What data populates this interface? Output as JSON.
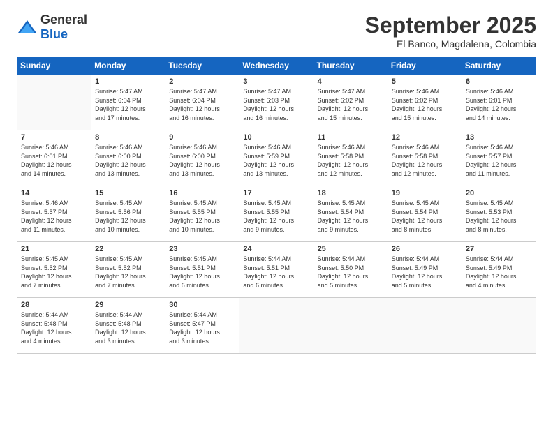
{
  "header": {
    "logo_general": "General",
    "logo_blue": "Blue",
    "month": "September 2025",
    "location": "El Banco, Magdalena, Colombia"
  },
  "weekdays": [
    "Sunday",
    "Monday",
    "Tuesday",
    "Wednesday",
    "Thursday",
    "Friday",
    "Saturday"
  ],
  "weeks": [
    [
      {
        "day": "",
        "info": ""
      },
      {
        "day": "1",
        "info": "Sunrise: 5:47 AM\nSunset: 6:04 PM\nDaylight: 12 hours\nand 17 minutes."
      },
      {
        "day": "2",
        "info": "Sunrise: 5:47 AM\nSunset: 6:04 PM\nDaylight: 12 hours\nand 16 minutes."
      },
      {
        "day": "3",
        "info": "Sunrise: 5:47 AM\nSunset: 6:03 PM\nDaylight: 12 hours\nand 16 minutes."
      },
      {
        "day": "4",
        "info": "Sunrise: 5:47 AM\nSunset: 6:02 PM\nDaylight: 12 hours\nand 15 minutes."
      },
      {
        "day": "5",
        "info": "Sunrise: 5:46 AM\nSunset: 6:02 PM\nDaylight: 12 hours\nand 15 minutes."
      },
      {
        "day": "6",
        "info": "Sunrise: 5:46 AM\nSunset: 6:01 PM\nDaylight: 12 hours\nand 14 minutes."
      }
    ],
    [
      {
        "day": "7",
        "info": "Sunrise: 5:46 AM\nSunset: 6:01 PM\nDaylight: 12 hours\nand 14 minutes."
      },
      {
        "day": "8",
        "info": "Sunrise: 5:46 AM\nSunset: 6:00 PM\nDaylight: 12 hours\nand 13 minutes."
      },
      {
        "day": "9",
        "info": "Sunrise: 5:46 AM\nSunset: 6:00 PM\nDaylight: 12 hours\nand 13 minutes."
      },
      {
        "day": "10",
        "info": "Sunrise: 5:46 AM\nSunset: 5:59 PM\nDaylight: 12 hours\nand 13 minutes."
      },
      {
        "day": "11",
        "info": "Sunrise: 5:46 AM\nSunset: 5:58 PM\nDaylight: 12 hours\nand 12 minutes."
      },
      {
        "day": "12",
        "info": "Sunrise: 5:46 AM\nSunset: 5:58 PM\nDaylight: 12 hours\nand 12 minutes."
      },
      {
        "day": "13",
        "info": "Sunrise: 5:46 AM\nSunset: 5:57 PM\nDaylight: 12 hours\nand 11 minutes."
      }
    ],
    [
      {
        "day": "14",
        "info": "Sunrise: 5:46 AM\nSunset: 5:57 PM\nDaylight: 12 hours\nand 11 minutes."
      },
      {
        "day": "15",
        "info": "Sunrise: 5:45 AM\nSunset: 5:56 PM\nDaylight: 12 hours\nand 10 minutes."
      },
      {
        "day": "16",
        "info": "Sunrise: 5:45 AM\nSunset: 5:55 PM\nDaylight: 12 hours\nand 10 minutes."
      },
      {
        "day": "17",
        "info": "Sunrise: 5:45 AM\nSunset: 5:55 PM\nDaylight: 12 hours\nand 9 minutes."
      },
      {
        "day": "18",
        "info": "Sunrise: 5:45 AM\nSunset: 5:54 PM\nDaylight: 12 hours\nand 9 minutes."
      },
      {
        "day": "19",
        "info": "Sunrise: 5:45 AM\nSunset: 5:54 PM\nDaylight: 12 hours\nand 8 minutes."
      },
      {
        "day": "20",
        "info": "Sunrise: 5:45 AM\nSunset: 5:53 PM\nDaylight: 12 hours\nand 8 minutes."
      }
    ],
    [
      {
        "day": "21",
        "info": "Sunrise: 5:45 AM\nSunset: 5:52 PM\nDaylight: 12 hours\nand 7 minutes."
      },
      {
        "day": "22",
        "info": "Sunrise: 5:45 AM\nSunset: 5:52 PM\nDaylight: 12 hours\nand 7 minutes."
      },
      {
        "day": "23",
        "info": "Sunrise: 5:45 AM\nSunset: 5:51 PM\nDaylight: 12 hours\nand 6 minutes."
      },
      {
        "day": "24",
        "info": "Sunrise: 5:44 AM\nSunset: 5:51 PM\nDaylight: 12 hours\nand 6 minutes."
      },
      {
        "day": "25",
        "info": "Sunrise: 5:44 AM\nSunset: 5:50 PM\nDaylight: 12 hours\nand 5 minutes."
      },
      {
        "day": "26",
        "info": "Sunrise: 5:44 AM\nSunset: 5:49 PM\nDaylight: 12 hours\nand 5 minutes."
      },
      {
        "day": "27",
        "info": "Sunrise: 5:44 AM\nSunset: 5:49 PM\nDaylight: 12 hours\nand 4 minutes."
      }
    ],
    [
      {
        "day": "28",
        "info": "Sunrise: 5:44 AM\nSunset: 5:48 PM\nDaylight: 12 hours\nand 4 minutes."
      },
      {
        "day": "29",
        "info": "Sunrise: 5:44 AM\nSunset: 5:48 PM\nDaylight: 12 hours\nand 3 minutes."
      },
      {
        "day": "30",
        "info": "Sunrise: 5:44 AM\nSunset: 5:47 PM\nDaylight: 12 hours\nand 3 minutes."
      },
      {
        "day": "",
        "info": ""
      },
      {
        "day": "",
        "info": ""
      },
      {
        "day": "",
        "info": ""
      },
      {
        "day": "",
        "info": ""
      }
    ]
  ]
}
